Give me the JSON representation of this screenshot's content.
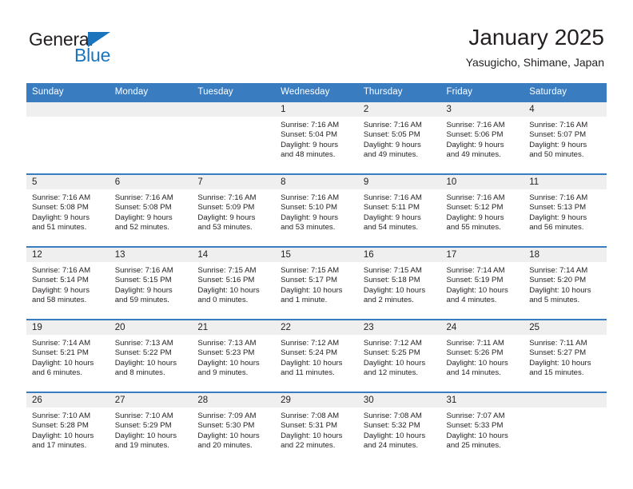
{
  "brand": {
    "word_one": "General",
    "word_two": "Blue",
    "triangle_icon": "triangle-icon",
    "accent_color": "#1c75bc"
  },
  "header": {
    "title": "January 2025",
    "subtitle": "Yasugicho, Shimane, Japan"
  },
  "theme": {
    "header_bg": "#3a7cc0",
    "daynum_bg": "#efefef",
    "text": "#231f20"
  },
  "weekday_headers": [
    "Sunday",
    "Monday",
    "Tuesday",
    "Wednesday",
    "Thursday",
    "Friday",
    "Saturday"
  ],
  "weeks": [
    [
      {
        "day": "",
        "sunrise": "",
        "sunset": "",
        "daylight_line1": "",
        "daylight_line2": ""
      },
      {
        "day": "",
        "sunrise": "",
        "sunset": "",
        "daylight_line1": "",
        "daylight_line2": ""
      },
      {
        "day": "",
        "sunrise": "",
        "sunset": "",
        "daylight_line1": "",
        "daylight_line2": ""
      },
      {
        "day": "1",
        "sunrise": "Sunrise: 7:16 AM",
        "sunset": "Sunset: 5:04 PM",
        "daylight_line1": "Daylight: 9 hours",
        "daylight_line2": "and 48 minutes."
      },
      {
        "day": "2",
        "sunrise": "Sunrise: 7:16 AM",
        "sunset": "Sunset: 5:05 PM",
        "daylight_line1": "Daylight: 9 hours",
        "daylight_line2": "and 49 minutes."
      },
      {
        "day": "3",
        "sunrise": "Sunrise: 7:16 AM",
        "sunset": "Sunset: 5:06 PM",
        "daylight_line1": "Daylight: 9 hours",
        "daylight_line2": "and 49 minutes."
      },
      {
        "day": "4",
        "sunrise": "Sunrise: 7:16 AM",
        "sunset": "Sunset: 5:07 PM",
        "daylight_line1": "Daylight: 9 hours",
        "daylight_line2": "and 50 minutes."
      }
    ],
    [
      {
        "day": "5",
        "sunrise": "Sunrise: 7:16 AM",
        "sunset": "Sunset: 5:08 PM",
        "daylight_line1": "Daylight: 9 hours",
        "daylight_line2": "and 51 minutes."
      },
      {
        "day": "6",
        "sunrise": "Sunrise: 7:16 AM",
        "sunset": "Sunset: 5:08 PM",
        "daylight_line1": "Daylight: 9 hours",
        "daylight_line2": "and 52 minutes."
      },
      {
        "day": "7",
        "sunrise": "Sunrise: 7:16 AM",
        "sunset": "Sunset: 5:09 PM",
        "daylight_line1": "Daylight: 9 hours",
        "daylight_line2": "and 53 minutes."
      },
      {
        "day": "8",
        "sunrise": "Sunrise: 7:16 AM",
        "sunset": "Sunset: 5:10 PM",
        "daylight_line1": "Daylight: 9 hours",
        "daylight_line2": "and 53 minutes."
      },
      {
        "day": "9",
        "sunrise": "Sunrise: 7:16 AM",
        "sunset": "Sunset: 5:11 PM",
        "daylight_line1": "Daylight: 9 hours",
        "daylight_line2": "and 54 minutes."
      },
      {
        "day": "10",
        "sunrise": "Sunrise: 7:16 AM",
        "sunset": "Sunset: 5:12 PM",
        "daylight_line1": "Daylight: 9 hours",
        "daylight_line2": "and 55 minutes."
      },
      {
        "day": "11",
        "sunrise": "Sunrise: 7:16 AM",
        "sunset": "Sunset: 5:13 PM",
        "daylight_line1": "Daylight: 9 hours",
        "daylight_line2": "and 56 minutes."
      }
    ],
    [
      {
        "day": "12",
        "sunrise": "Sunrise: 7:16 AM",
        "sunset": "Sunset: 5:14 PM",
        "daylight_line1": "Daylight: 9 hours",
        "daylight_line2": "and 58 minutes."
      },
      {
        "day": "13",
        "sunrise": "Sunrise: 7:16 AM",
        "sunset": "Sunset: 5:15 PM",
        "daylight_line1": "Daylight: 9 hours",
        "daylight_line2": "and 59 minutes."
      },
      {
        "day": "14",
        "sunrise": "Sunrise: 7:15 AM",
        "sunset": "Sunset: 5:16 PM",
        "daylight_line1": "Daylight: 10 hours",
        "daylight_line2": "and 0 minutes."
      },
      {
        "day": "15",
        "sunrise": "Sunrise: 7:15 AM",
        "sunset": "Sunset: 5:17 PM",
        "daylight_line1": "Daylight: 10 hours",
        "daylight_line2": "and 1 minute."
      },
      {
        "day": "16",
        "sunrise": "Sunrise: 7:15 AM",
        "sunset": "Sunset: 5:18 PM",
        "daylight_line1": "Daylight: 10 hours",
        "daylight_line2": "and 2 minutes."
      },
      {
        "day": "17",
        "sunrise": "Sunrise: 7:14 AM",
        "sunset": "Sunset: 5:19 PM",
        "daylight_line1": "Daylight: 10 hours",
        "daylight_line2": "and 4 minutes."
      },
      {
        "day": "18",
        "sunrise": "Sunrise: 7:14 AM",
        "sunset": "Sunset: 5:20 PM",
        "daylight_line1": "Daylight: 10 hours",
        "daylight_line2": "and 5 minutes."
      }
    ],
    [
      {
        "day": "19",
        "sunrise": "Sunrise: 7:14 AM",
        "sunset": "Sunset: 5:21 PM",
        "daylight_line1": "Daylight: 10 hours",
        "daylight_line2": "and 6 minutes."
      },
      {
        "day": "20",
        "sunrise": "Sunrise: 7:13 AM",
        "sunset": "Sunset: 5:22 PM",
        "daylight_line1": "Daylight: 10 hours",
        "daylight_line2": "and 8 minutes."
      },
      {
        "day": "21",
        "sunrise": "Sunrise: 7:13 AM",
        "sunset": "Sunset: 5:23 PM",
        "daylight_line1": "Daylight: 10 hours",
        "daylight_line2": "and 9 minutes."
      },
      {
        "day": "22",
        "sunrise": "Sunrise: 7:12 AM",
        "sunset": "Sunset: 5:24 PM",
        "daylight_line1": "Daylight: 10 hours",
        "daylight_line2": "and 11 minutes."
      },
      {
        "day": "23",
        "sunrise": "Sunrise: 7:12 AM",
        "sunset": "Sunset: 5:25 PM",
        "daylight_line1": "Daylight: 10 hours",
        "daylight_line2": "and 12 minutes."
      },
      {
        "day": "24",
        "sunrise": "Sunrise: 7:11 AM",
        "sunset": "Sunset: 5:26 PM",
        "daylight_line1": "Daylight: 10 hours",
        "daylight_line2": "and 14 minutes."
      },
      {
        "day": "25",
        "sunrise": "Sunrise: 7:11 AM",
        "sunset": "Sunset: 5:27 PM",
        "daylight_line1": "Daylight: 10 hours",
        "daylight_line2": "and 15 minutes."
      }
    ],
    [
      {
        "day": "26",
        "sunrise": "Sunrise: 7:10 AM",
        "sunset": "Sunset: 5:28 PM",
        "daylight_line1": "Daylight: 10 hours",
        "daylight_line2": "and 17 minutes."
      },
      {
        "day": "27",
        "sunrise": "Sunrise: 7:10 AM",
        "sunset": "Sunset: 5:29 PM",
        "daylight_line1": "Daylight: 10 hours",
        "daylight_line2": "and 19 minutes."
      },
      {
        "day": "28",
        "sunrise": "Sunrise: 7:09 AM",
        "sunset": "Sunset: 5:30 PM",
        "daylight_line1": "Daylight: 10 hours",
        "daylight_line2": "and 20 minutes."
      },
      {
        "day": "29",
        "sunrise": "Sunrise: 7:08 AM",
        "sunset": "Sunset: 5:31 PM",
        "daylight_line1": "Daylight: 10 hours",
        "daylight_line2": "and 22 minutes."
      },
      {
        "day": "30",
        "sunrise": "Sunrise: 7:08 AM",
        "sunset": "Sunset: 5:32 PM",
        "daylight_line1": "Daylight: 10 hours",
        "daylight_line2": "and 24 minutes."
      },
      {
        "day": "31",
        "sunrise": "Sunrise: 7:07 AM",
        "sunset": "Sunset: 5:33 PM",
        "daylight_line1": "Daylight: 10 hours",
        "daylight_line2": "and 25 minutes."
      },
      {
        "day": "",
        "sunrise": "",
        "sunset": "",
        "daylight_line1": "",
        "daylight_line2": ""
      }
    ]
  ]
}
